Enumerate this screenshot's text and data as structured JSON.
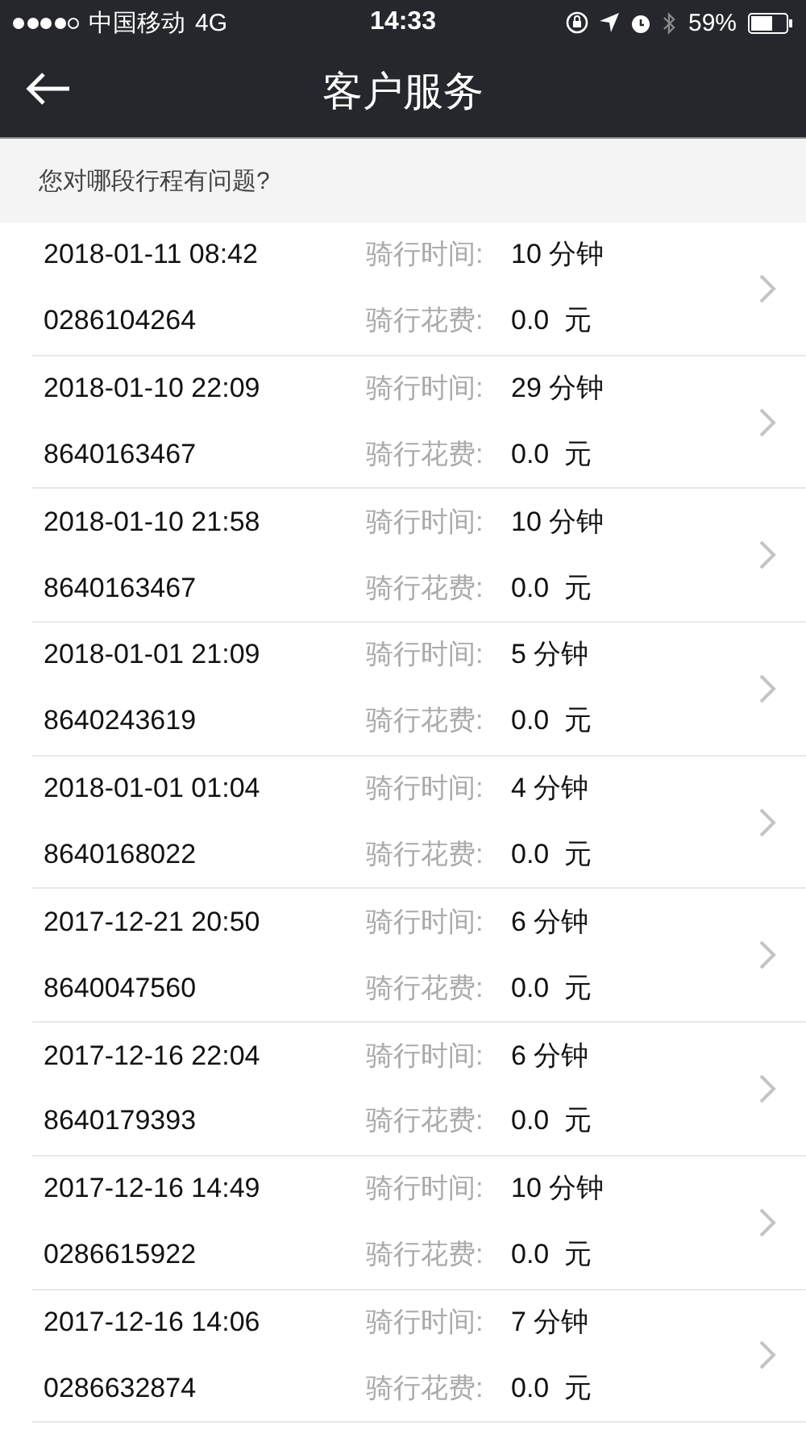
{
  "status_bar": {
    "carrier": "中国移动",
    "network": "4G",
    "time": "14:33",
    "battery": "59%"
  },
  "nav": {
    "title": "客户服务"
  },
  "prompt": "您对哪段行程有问题?",
  "trips": [
    {
      "datetime": "2018-01-11 08:42",
      "bike_id": "0286104264",
      "duration_label": "骑行时间:",
      "duration": "10 分钟",
      "cost_label": "骑行花费:",
      "cost": "0.0  元"
    },
    {
      "datetime": "2018-01-10 22:09",
      "bike_id": "8640163467",
      "duration_label": "骑行时间:",
      "duration": "29 分钟",
      "cost_label": "骑行花费:",
      "cost": "0.0  元"
    },
    {
      "datetime": "2018-01-10 21:58",
      "bike_id": "8640163467",
      "duration_label": "骑行时间:",
      "duration": "10 分钟",
      "cost_label": "骑行花费:",
      "cost": "0.0  元"
    },
    {
      "datetime": "2018-01-01 21:09",
      "bike_id": "8640243619",
      "duration_label": "骑行时间:",
      "duration": "5 分钟",
      "cost_label": "骑行花费:",
      "cost": "0.0  元"
    },
    {
      "datetime": "2018-01-01 01:04",
      "bike_id": "8640168022",
      "duration_label": "骑行时间:",
      "duration": "4 分钟",
      "cost_label": "骑行花费:",
      "cost": "0.0  元"
    },
    {
      "datetime": "2017-12-21 20:50",
      "bike_id": "8640047560",
      "duration_label": "骑行时间:",
      "duration": "6 分钟",
      "cost_label": "骑行花费:",
      "cost": "0.0  元"
    },
    {
      "datetime": "2017-12-16 22:04",
      "bike_id": "8640179393",
      "duration_label": "骑行时间:",
      "duration": "6 分钟",
      "cost_label": "骑行花费:",
      "cost": "0.0  元"
    },
    {
      "datetime": "2017-12-16 14:49",
      "bike_id": "0286615922",
      "duration_label": "骑行时间:",
      "duration": "10 分钟",
      "cost_label": "骑行花费:",
      "cost": "0.0  元"
    },
    {
      "datetime": "2017-12-16 14:06",
      "bike_id": "0286632874",
      "duration_label": "骑行时间:",
      "duration": "7 分钟",
      "cost_label": "骑行花费:",
      "cost": "0.0  元"
    }
  ]
}
